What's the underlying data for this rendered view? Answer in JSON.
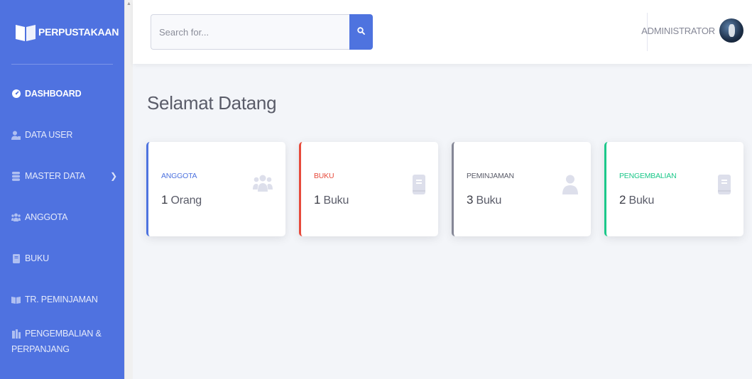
{
  "brand": {
    "name": "PERPUSTAKAAN"
  },
  "sidebar": {
    "items": [
      {
        "label": "DASHBOARD",
        "icon": "tachometer-icon"
      },
      {
        "label": "DATA USER",
        "icon": "user-tie-icon"
      },
      {
        "label": "MASTER DATA",
        "icon": "database-icon"
      },
      {
        "label": "ANGGOTA",
        "icon": "users-icon"
      },
      {
        "label": "BUKU",
        "icon": "book-icon"
      },
      {
        "label": "TR. PEMINJAMAN",
        "icon": "book-open-icon"
      },
      {
        "label_line1": "PENGEMBALIAN &",
        "label_line2": "PERPANJANG",
        "icon": "book-return-icon"
      }
    ]
  },
  "topbar": {
    "search_placeholder": "Search for...",
    "user_name": "ADMINISTRATOR"
  },
  "main": {
    "title": "Selamat Datang",
    "cards": [
      {
        "label": "ANGGOTA",
        "number": "1",
        "unit": "Orang",
        "color": "#4e73df",
        "icon": "users-icon"
      },
      {
        "label": "BUKU",
        "number": "1",
        "unit": "Buku",
        "color": "#e74a3b",
        "icon": "book-icon"
      },
      {
        "label": "PEMINJAMAN",
        "number": "3",
        "unit": "Buku",
        "color": "#858796",
        "icon": "user-icon"
      },
      {
        "label": "PENGEMBALIAN",
        "number": "2",
        "unit": "Buku",
        "color": "#1cc88a",
        "icon": "book-icon"
      }
    ]
  },
  "colors": {
    "sidebar": "#4f72e0",
    "primary": "#4e73df",
    "danger": "#e74a3b",
    "secondary": "#858796",
    "success": "#1cc88a"
  }
}
